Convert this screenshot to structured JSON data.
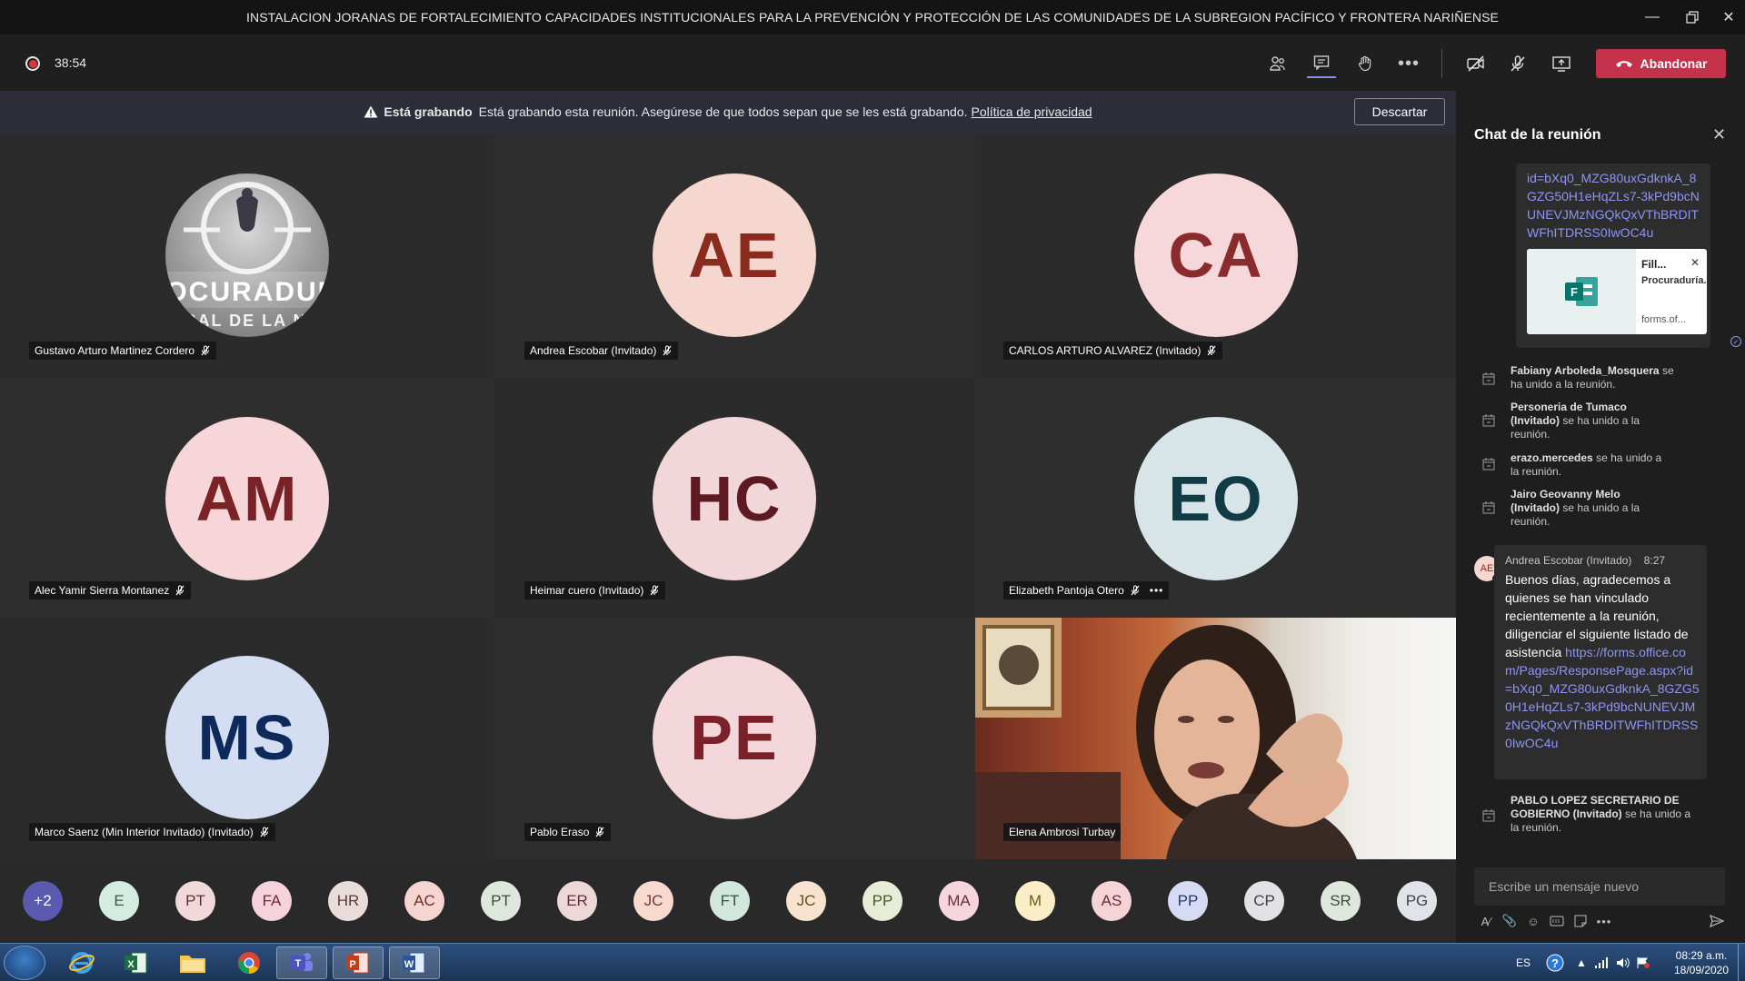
{
  "window": {
    "title": "INSTALACION JORANAS DE FORTALECIMIENTO CAPACIDADES INSTITUCIONALES PARA LA PREVENCIÓN Y PROTECCIÓN DE LAS COMUNIDADES DE LA SUBREGION PACÍFICO Y FRONTERA NARIÑENSE"
  },
  "toolbar": {
    "timer": "38:54",
    "leave_label": "Abandonar"
  },
  "banner": {
    "bold": "Está grabando",
    "text": "Está grabando esta reunión. Asegúrese de que todos sepan que se les está grabando.",
    "link": "Política de privacidad",
    "dismiss": "Descartar"
  },
  "participants": [
    {
      "name": "Gustavo Arturo Martinez Cordero",
      "initials": "",
      "logo_text": "PROCURADURIA",
      "logo_sub": "NERAL DE LA NACI",
      "muted": true
    },
    {
      "name": "Andrea Escobar (Invitado)",
      "initials": "AE",
      "muted": true,
      "bg": "#f6d7cf",
      "fg": "#8a2b1e"
    },
    {
      "name": "CARLOS ARTURO ALVAREZ (Invitado)",
      "initials": "CA",
      "muted": true,
      "bg": "#f6d7da",
      "fg": "#8a2b2e"
    },
    {
      "name": "Alec Yamir Sierra Montanez",
      "initials": "AM",
      "muted": true,
      "bg": "#f6d6d8",
      "fg": "#7a2226"
    },
    {
      "name": "Heimar cuero (Invitado)",
      "initials": "HC",
      "muted": true,
      "bg": "#f1d6da",
      "fg": "#5e1a22"
    },
    {
      "name": "Elizabeth Pantoja Otero",
      "initials": "EO",
      "muted": true,
      "bg": "#d8e5e8",
      "fg": "#123c45"
    },
    {
      "name": "Marco Saenz (Min Interior Invitado) (Invitado)",
      "initials": "MS",
      "muted": true,
      "bg": "#d3def2",
      "fg": "#0e2a5c"
    },
    {
      "name": "Pablo Eraso",
      "initials": "PE",
      "muted": true,
      "bg": "#f3d7da",
      "fg": "#7a2129"
    },
    {
      "name": "Elena Ambrosi Turbay",
      "initials": "",
      "muted": false
    }
  ],
  "roster": [
    {
      "label": "+2",
      "bg": "#5a5bb0",
      "fg": "#ffffff"
    },
    {
      "label": "E",
      "bg": "#d4ecdf",
      "fg": "#355c46"
    },
    {
      "label": "PT",
      "bg": "#f1d8db",
      "fg": "#5b2e33"
    },
    {
      "label": "FA",
      "bg": "#f6d2dc",
      "fg": "#6b2d3d"
    },
    {
      "label": "HR",
      "bg": "#eadcda",
      "fg": "#5a3b37"
    },
    {
      "label": "AC",
      "bg": "#f6d5d0",
      "fg": "#6e2f27"
    },
    {
      "label": "PT",
      "bg": "#dde7dc",
      "fg": "#3c4f3a"
    },
    {
      "label": "ER",
      "bg": "#edd7d8",
      "fg": "#5e3336"
    },
    {
      "label": "JC",
      "bg": "#f7d9cf",
      "fg": "#7a3a24"
    },
    {
      "label": "FT",
      "bg": "#d3e8dc",
      "fg": "#335544"
    },
    {
      "label": "JC",
      "bg": "#f7e3cf",
      "fg": "#6e4a23"
    },
    {
      "label": "PP",
      "bg": "#e6ecd6",
      "fg": "#4b5730"
    },
    {
      "label": "MA",
      "bg": "#f6d6dc",
      "fg": "#6b2d3a"
    },
    {
      "label": "M",
      "bg": "#fbeec6",
      "fg": "#6e5a18"
    },
    {
      "label": "AS",
      "bg": "#f6d3d6",
      "fg": "#6e2a30"
    },
    {
      "label": "PP",
      "bg": "#d4dbf2",
      "fg": "#2b3a6e"
    },
    {
      "label": "CP",
      "bg": "#e2e2e6",
      "fg": "#40404a"
    },
    {
      "label": "SR",
      "bg": "#dfe6dc",
      "fg": "#3f4c3b"
    },
    {
      "label": "PG",
      "bg": "#e0e4e8",
      "fg": "#3b4450"
    }
  ],
  "chat": {
    "title": "Chat de la reunión",
    "top_link": "id=bXq0_MZG80uxGdknkA_8GZG50H1eHqZLs7-3kPd9bcNUNEVJMzNGQkQxVThBRDITWFhITDRSS0IwOC4u",
    "card": {
      "title": "Fill...",
      "subtitle": "Procuraduría...",
      "domain": "forms.of..."
    },
    "system": [
      {
        "name": "Fabiany Arboleda_Mosquera",
        "text": "se ha unido a la reunión."
      },
      {
        "name": "Personeria de Tumaco (Invitado)",
        "text": "se ha unido a la reunión."
      },
      {
        "name": "erazo.mercedes",
        "text": "se ha unido a la reunión."
      },
      {
        "name": "Jairo Geovanny Melo (Invitado)",
        "text": "se ha unido a la reunión."
      },
      {
        "name": "PABLO LOPEZ SECRETARIO DE GOBIERNO (Invitado)",
        "text": "se ha unido a la reunión."
      }
    ],
    "message": {
      "author": "Andrea Escobar (Invitado)",
      "time": "8:27",
      "initials": "AE",
      "text": "Buenos días, agradecemos a quienes se han vinculado recientemente a la reunión, diligenciar el siguiente listado de asistencia",
      "link": "https://forms.office.com/Pages/ResponsePage.aspx?id=bXq0_MZG80uxGdknkA_8GZG50H1eHqZLs7-3kPd9bcNUNEVJMzNGQkQxVThBRDITWFhITDRSS0IwOC4u"
    },
    "compose_placeholder": "Escribe un mensaje nuevo"
  },
  "taskbar": {
    "lang": "ES",
    "time": "08:29 a.m.",
    "date": "18/09/2020"
  }
}
